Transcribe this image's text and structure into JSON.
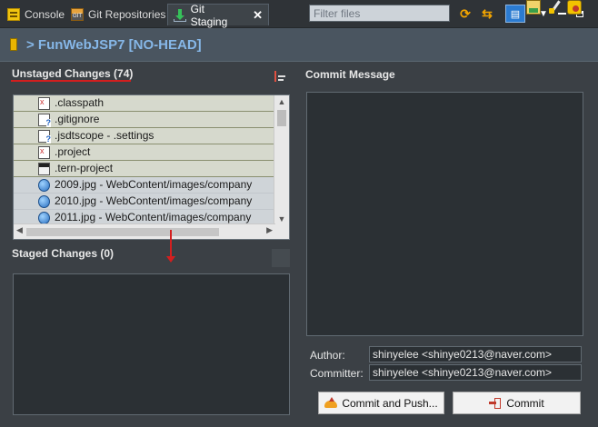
{
  "tabs": [
    {
      "label": "Console",
      "icon": "console-icon"
    },
    {
      "label": "Git Repositories",
      "icon": "git-repositories-icon"
    },
    {
      "label": "Git Staging",
      "icon": "git-staging-icon",
      "active": true
    }
  ],
  "toolbar": {
    "filter_placeholder": "Filter files",
    "icons": [
      "refresh-icon",
      "swap-icon",
      "layout-icon",
      "view-menu-icon",
      "minimize-icon",
      "maximize-icon"
    ]
  },
  "repository": {
    "title": "> FunWebJSP7 [NO-HEAD]"
  },
  "unstaged": {
    "title": "Unstaged Changes (74)",
    "files": [
      {
        "name": ".classpath",
        "icon": "xml-file-icon"
      },
      {
        "name": ".gitignore",
        "icon": "untracked-file-icon"
      },
      {
        "name": ".jsdtscope - .settings",
        "icon": "untracked-file-icon"
      },
      {
        "name": ".project",
        "icon": "xml-file-icon"
      },
      {
        "name": ".tern-project",
        "icon": "tern-file-icon"
      },
      {
        "name": "2009.jpg - WebContent/images/company",
        "icon": "image-file-icon"
      },
      {
        "name": "2010.jpg - WebContent/images/company",
        "icon": "image-file-icon"
      },
      {
        "name": "2011.jpg - WebContent/images/company",
        "icon": "image-file-icon"
      }
    ]
  },
  "staged": {
    "title": "Staged Changes (0)"
  },
  "commit": {
    "title": "Commit Message",
    "message": "",
    "author_label": "Author:",
    "author_value": "shinyelee <shinye0213@naver.com>",
    "committer_label": "Committer:",
    "committer_value": "shinyelee <shinye0213@naver.com>",
    "push_label": "Commit and Push...",
    "commit_label": "Commit"
  },
  "colors": {
    "background": "#3b4045",
    "repo_title": "#86b7e8",
    "annotation_red": "#d21e1e"
  }
}
